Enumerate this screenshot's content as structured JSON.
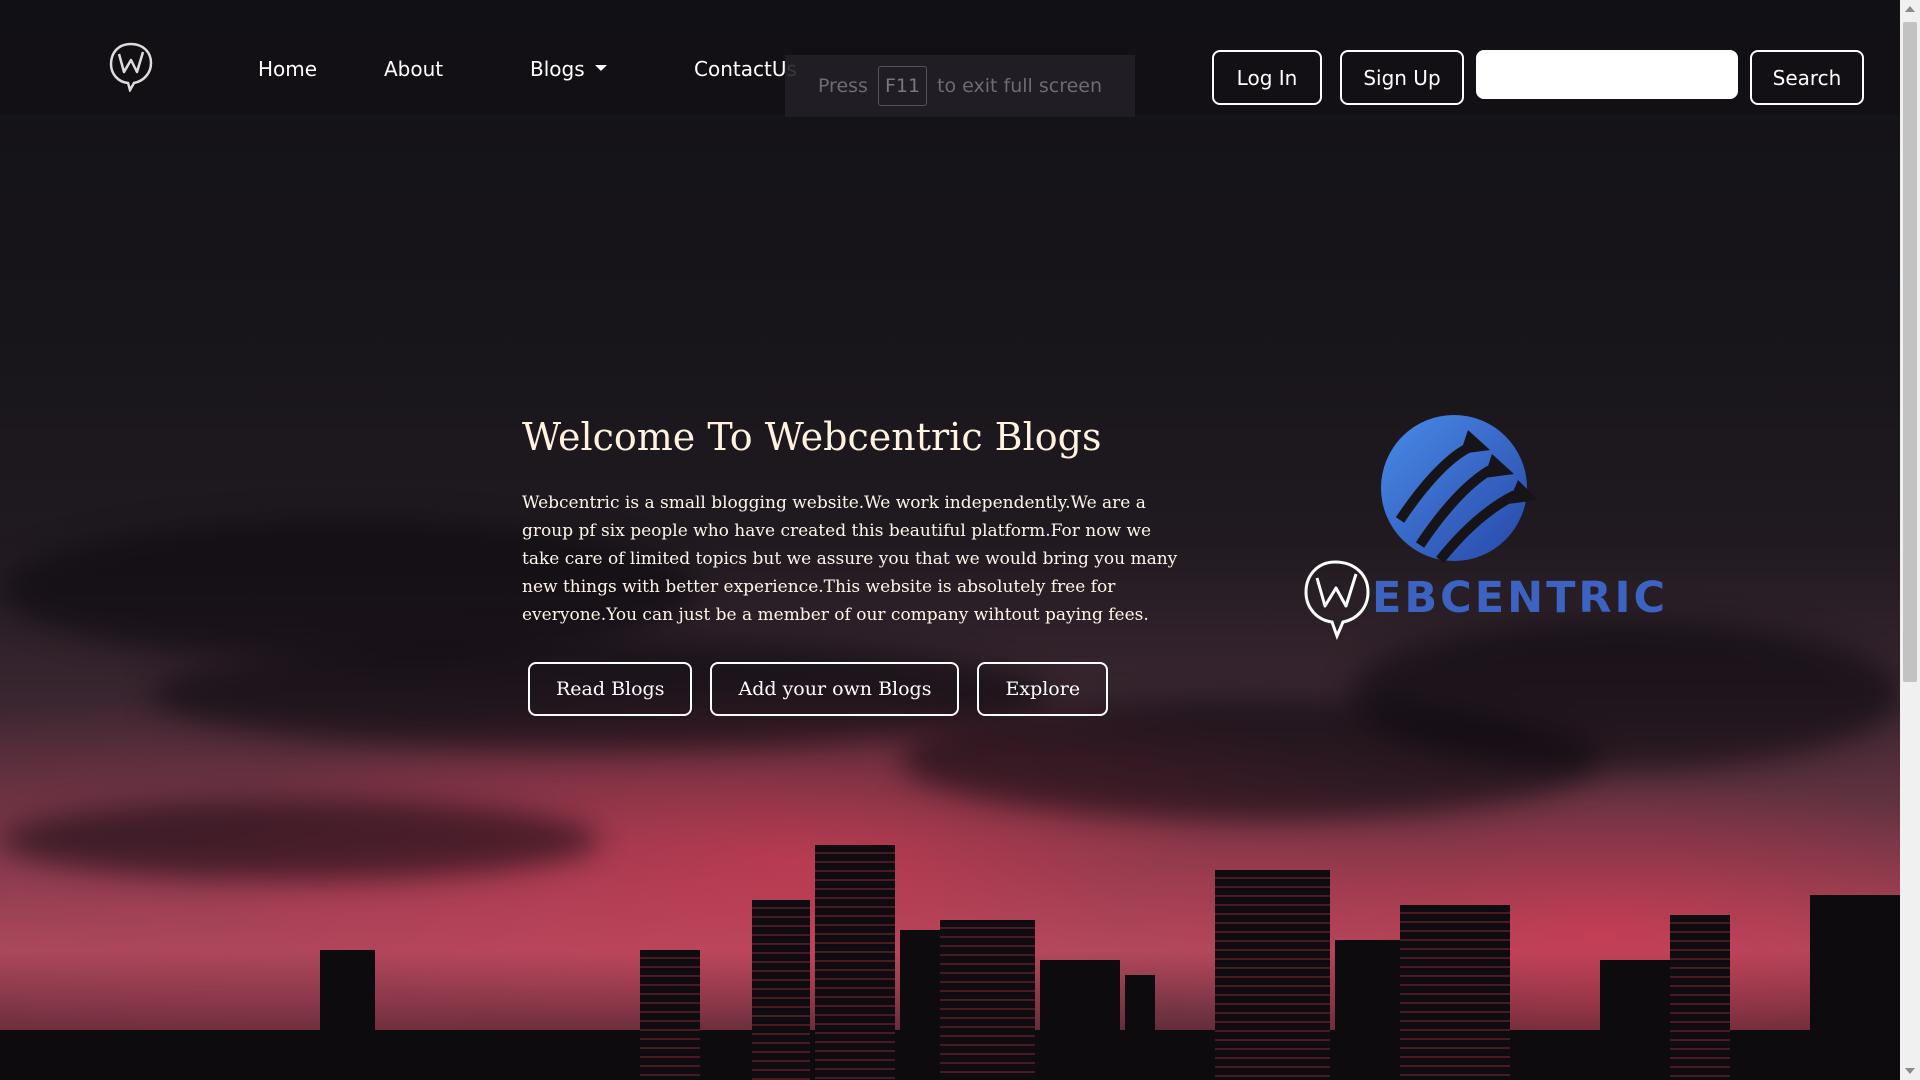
{
  "navbar": {
    "brand_icon": "webcentric-w-icon",
    "links": [
      "Home",
      "About",
      "Blogs",
      "ContactUs"
    ],
    "login_label": "Log In",
    "signup_label": "Sign Up",
    "search_placeholder": "",
    "search_label": "Search"
  },
  "fullscreen_notice": {
    "press": "Press",
    "key": "F11",
    "rest": "to exit full screen"
  },
  "hero": {
    "title": "Welcome To Webcentric Blogs",
    "description": "Webcentric is a small blogging website.We work independently.We are a group pf six people who have created this beautiful platform.For now we take care of limited topics but we assure you that we would bring you many new things with better experience.This website is absolutely free for everyone.You can just be a member of our company wihtout paying fees.",
    "buttons": [
      "Read Blogs",
      "Add your own Blogs",
      "Explore"
    ]
  },
  "logo": {
    "wordmark": "EBCENTRIC",
    "brand_color": "#3c63c2"
  }
}
